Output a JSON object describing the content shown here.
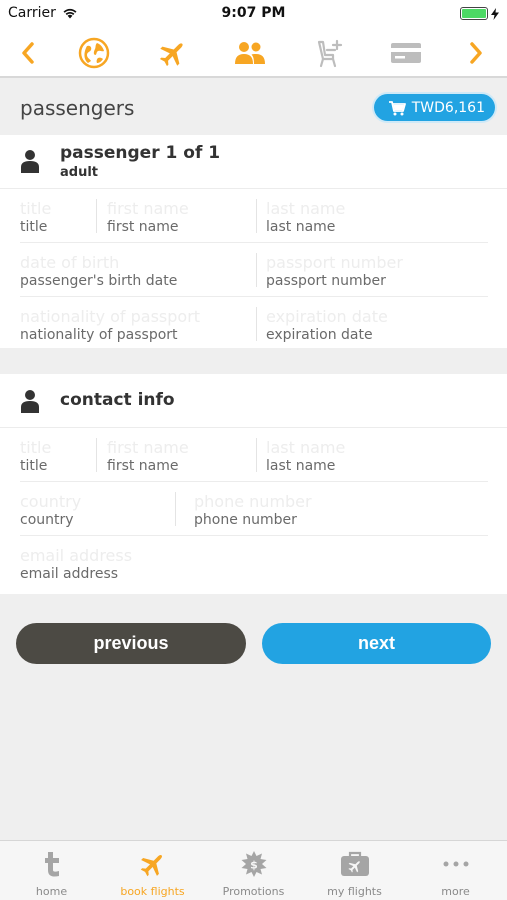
{
  "status_bar": {
    "carrier": "Carrier",
    "time": "9:07 PM"
  },
  "top_nav": {
    "accent_color": "#f7a623",
    "icons": [
      "chevron-left-icon",
      "globe-icon",
      "airplane-icon",
      "passengers-icon",
      "seat-icon",
      "credit-card-icon",
      "chevron-right-icon"
    ]
  },
  "header": {
    "title": "passengers",
    "cart_total": "TWD6,161"
  },
  "passenger": {
    "title": "passenger 1 of 1",
    "subtitle": "adult",
    "fields": {
      "title": {
        "placeholder": "title",
        "label": "title"
      },
      "first_name": {
        "placeholder": "first name",
        "label": "first name"
      },
      "last_name": {
        "placeholder": "last name",
        "label": "last name"
      },
      "dob": {
        "placeholder": "date of birth",
        "label": "passenger's birth date"
      },
      "passport_number": {
        "placeholder": "passport number",
        "label": "passport number"
      },
      "nationality": {
        "placeholder": "nationality of passport",
        "label": "nationality of passport"
      },
      "expiration": {
        "placeholder": "expiration date",
        "label": "expiration date"
      }
    }
  },
  "contact": {
    "title": "contact info",
    "fields": {
      "title": {
        "placeholder": "title",
        "label": "title"
      },
      "first_name": {
        "placeholder": "first name",
        "label": "first name"
      },
      "last_name": {
        "placeholder": "last name",
        "label": "last name"
      },
      "country": {
        "placeholder": "country",
        "label": "country"
      },
      "phone": {
        "placeholder": "phone number",
        "label": "phone number"
      },
      "email": {
        "placeholder": "email address",
        "label": "email address"
      }
    }
  },
  "buttons": {
    "previous": "previous",
    "next": "next"
  },
  "tab_bar": {
    "active_tab": "book flights",
    "tabs": [
      {
        "label": "home",
        "icon": "t-logo-icon"
      },
      {
        "label": "book flights",
        "icon": "airplane-icon"
      },
      {
        "label": "Promotions",
        "icon": "promotions-icon"
      },
      {
        "label": "my flights",
        "icon": "suitcase-icon"
      },
      {
        "label": "more",
        "icon": "more-dots-icon"
      }
    ]
  },
  "colors": {
    "primary_blue": "#22a3e2",
    "orange": "#f7a623",
    "dark_button": "#4c4a44"
  }
}
